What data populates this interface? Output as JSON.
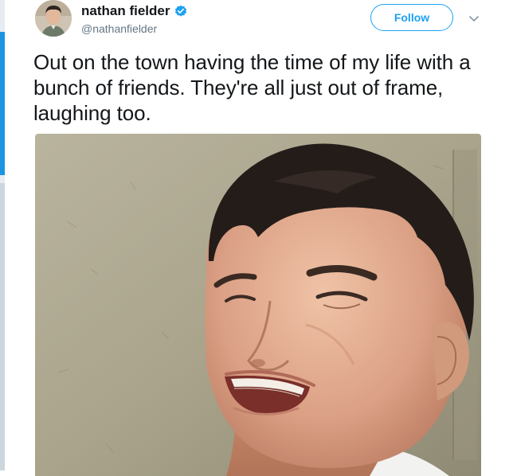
{
  "user": {
    "display_name": "nathan fielder",
    "handle": "@nathanfielder",
    "verified": true
  },
  "actions": {
    "follow_label": "Follow"
  },
  "tweet": {
    "text": "Out on the town having the time of my life with a bunch of friends. They're all just out of frame, laughing too."
  },
  "icons": {
    "verified": "verified-badge-icon",
    "more": "chevron-down-icon"
  },
  "colors": {
    "accent": "#1da1f2",
    "text": "#14171a",
    "secondary_text": "#657786"
  }
}
